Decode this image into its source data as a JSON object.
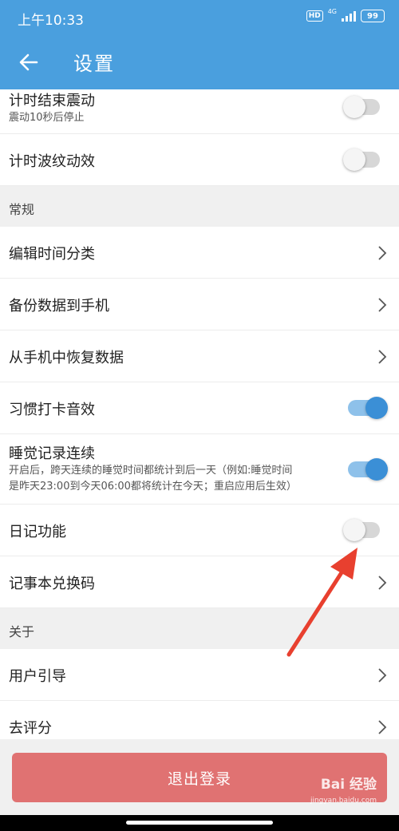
{
  "status_bar": {
    "time": "上午10:33",
    "hd": "HD",
    "network": "4G",
    "battery": "99"
  },
  "app_bar": {
    "title": "设置",
    "back_icon": "arrow-left-icon"
  },
  "rows": [
    {
      "title": "计时结束震动",
      "subtitle": "震动10秒后停止",
      "control": "toggle",
      "on": false
    },
    {
      "title": "计时波纹动效",
      "control": "toggle",
      "on": false
    },
    {
      "section": "常规"
    },
    {
      "title": "编辑时间分类",
      "control": "chevron"
    },
    {
      "title": "备份数据到手机",
      "control": "chevron"
    },
    {
      "title": "从手机中恢复数据",
      "control": "chevron"
    },
    {
      "title": "习惯打卡音效",
      "control": "toggle",
      "on": true
    },
    {
      "title": "睡觉记录连续",
      "subtitle_lines": [
        "开启后，跨天连续的睡觉时间都统计到后一天（例如:睡觉时间",
        "是昨天23:00到今天06:00都将统计在今天；重启应用后生效）"
      ],
      "control": "toggle",
      "on": true
    },
    {
      "title": "日记功能",
      "control": "toggle",
      "on": false
    },
    {
      "title": "记事本兑换码",
      "control": "chevron"
    },
    {
      "section": "关于"
    },
    {
      "title": "用户引导",
      "control": "chevron"
    },
    {
      "title": "去评分",
      "control": "chevron"
    }
  ],
  "logout_label": "退出登录",
  "watermark": {
    "text": "Bai 经验",
    "sub": "jingyan.baidu.com"
  },
  "colors": {
    "primary": "#4a9fde",
    "toggle_on": "#3b8fd6",
    "logout": "#e07272",
    "annotation_arrow": "#e8402f"
  }
}
